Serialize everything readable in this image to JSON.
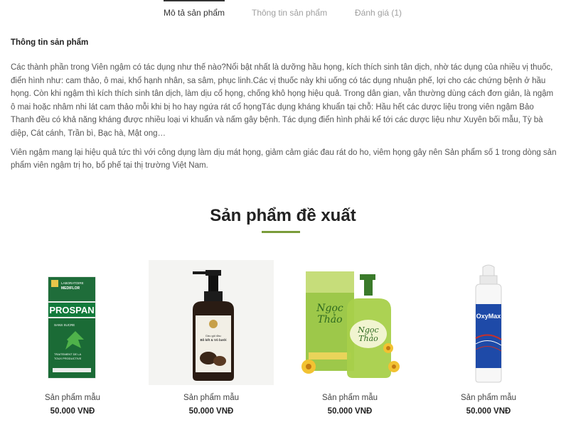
{
  "tabs": [
    {
      "label": "Mô tả sản phẩm"
    },
    {
      "label": "Thông tin sản phẩm"
    },
    {
      "label": "Đánh giá (1)"
    }
  ],
  "description": {
    "heading": "Thông tin sản phẩm",
    "paragraph1": "Các thành phần trong Viên ngậm có tác dụng như thế nào?Nổi bật nhất là dưỡng hầu họng, kích thích sinh tân dịch, nhờ tác dụng của nhiều vị thuốc, điển hình như: cam thảo, ô mai, khổ hạnh nhân, sa sâm, phục linh.Các vị thuốc này khi uống có tác dụng nhuận phế, lợi cho các chứng bệnh ở hầu họng. Còn khi ngậm thì kích thích sinh tân dịch, làm dịu cổ họng, chống khô họng hiệu quả. Trong dân gian, vẫn thường dùng cách đơn giản, là ngậm ô mai hoặc nhâm nhi lát cam thảo mỗi khi bị ho hay ngứa rát cổ họngTác dụng kháng khuẩn tại chỗ: Hầu hết các dược liệu trong viên ngậm Bảo Thanh đều có khả năng kháng được nhiều loại vi khuẩn và nấm gây bệnh. Tác dụng điển hình phải kể tới các dược liệu như Xuyên bối mẫu, Tỳ bà diệp, Cát cánh, Trần bì, Bạc hà, Mật ong…",
    "paragraph2": "Viên ngậm mang lại hiệu quả tức thì với công dụng làm dịu mát họng, giảm cảm giác đau rát do ho, viêm họng gây nên Sản phẩm số 1 trong dòng sản phẩm viên ngậm trị ho, bổ phế tại thị trường Việt Nam."
  },
  "related": {
    "title": "Sản phẩm đề xuất",
    "products": [
      {
        "name": "Sản phẩm mẫu",
        "price": "50.000 VNĐ",
        "image": "prospan-box",
        "box_lines": [
          "LABORATOIRE",
          "MEDIFLOR",
          "PROSPAN",
          "SANS SUCRE",
          "TRAITEMENT DE LA",
          "TOUX PRODUCTIVE"
        ]
      },
      {
        "name": "Sản phẩm mẫu",
        "price": "50.000 VNĐ",
        "image": "herbal-shampoo-bottle",
        "box_lines": [
          "Dầu gội đầu",
          "Bồ kết & Vỏ bưởi"
        ]
      },
      {
        "name": "Sản phẩm mẫu",
        "price": "50.000 VNĐ",
        "image": "ngoc-thao-soap-bottle",
        "box_lines": [
          "Ngọc",
          "Thảo"
        ]
      },
      {
        "name": "Sản phẩm mẫu",
        "price": "50.000 VNĐ",
        "image": "oxymax-spray-can",
        "box_lines": [
          "OxyMax"
        ]
      }
    ]
  },
  "colors": {
    "accent": "#7a9c3a",
    "tab_inactive": "#a0a0a0",
    "text": "#555555"
  }
}
